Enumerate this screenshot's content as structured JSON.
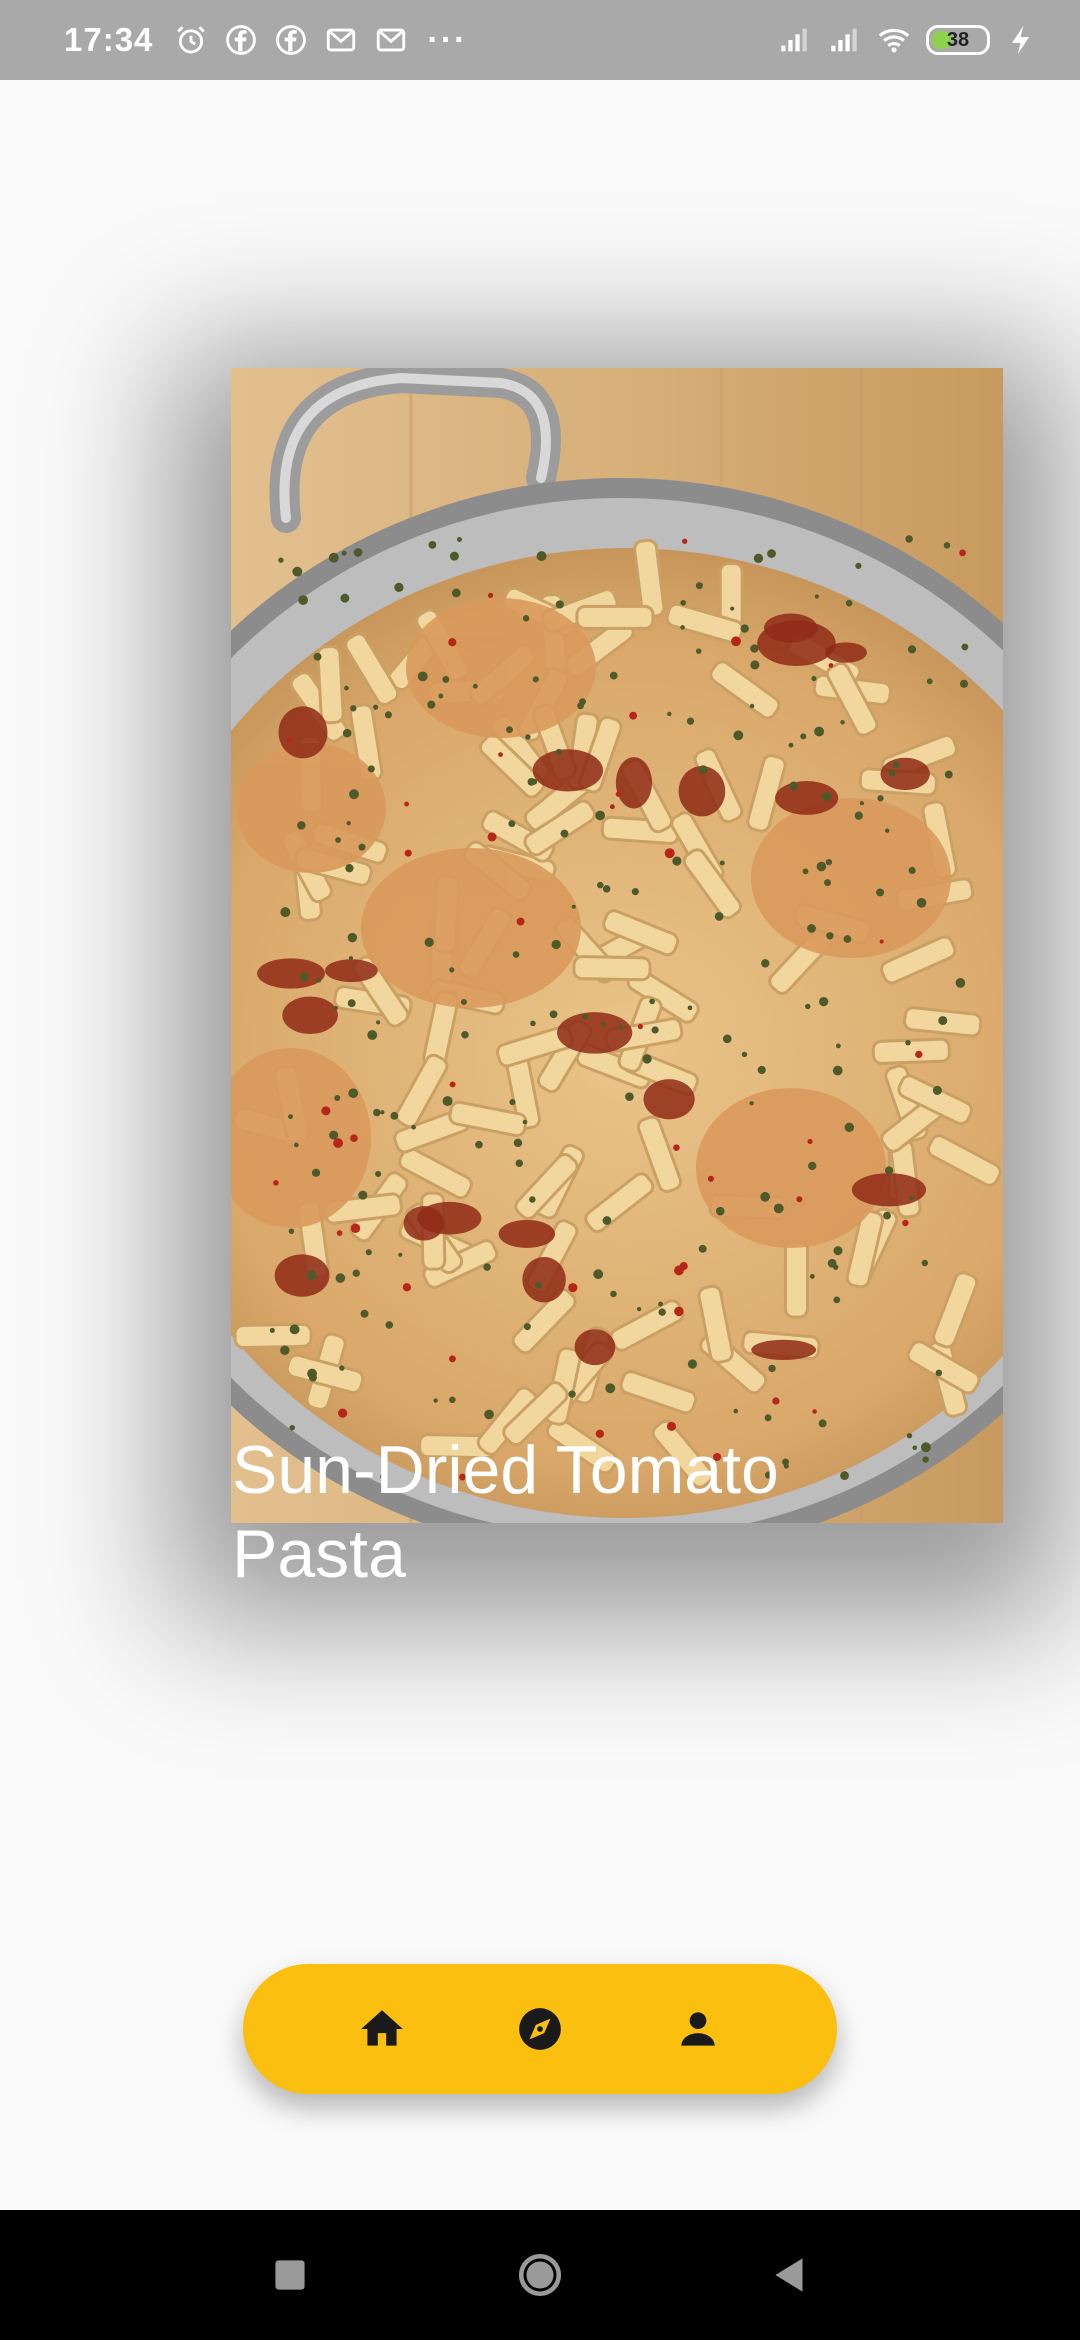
{
  "status_bar": {
    "time": "17:34",
    "battery_level": 38,
    "battery_text": "38",
    "icons_left": [
      "alarm-icon",
      "facebook-icon",
      "facebook-icon",
      "gmail-icon",
      "gmail-icon",
      "more-dots-icon"
    ],
    "more_label": "···",
    "icons_right": [
      "signal-icon",
      "signal-icon",
      "wifi-icon",
      "battery-icon",
      "charging-icon"
    ]
  },
  "recipe_card": {
    "title": "Sun-Dried Tomato Pasta",
    "image": "pasta-pan-image"
  },
  "bottom_nav": {
    "color": "#fbc00f",
    "items": [
      {
        "name": "home",
        "icon": "home-icon"
      },
      {
        "name": "explore",
        "icon": "compass-icon"
      },
      {
        "name": "profile",
        "icon": "person-icon"
      }
    ]
  },
  "system_nav": {
    "buttons": [
      "recents-button",
      "home-button",
      "back-button"
    ]
  }
}
